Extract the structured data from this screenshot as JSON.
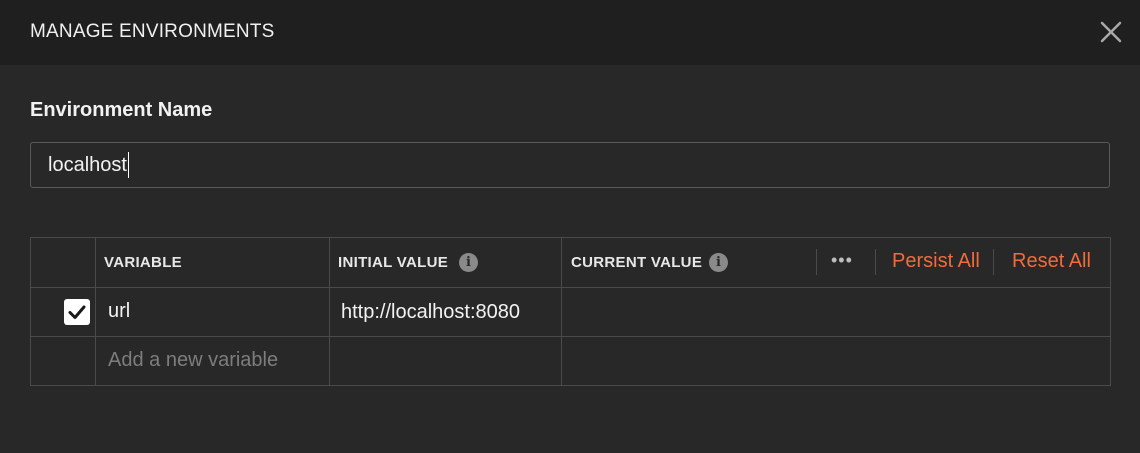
{
  "header": {
    "title": "MANAGE ENVIRONMENTS",
    "close_icon": "close-icon"
  },
  "environment": {
    "name_label": "Environment Name",
    "name_value": "localhost"
  },
  "table": {
    "columns": {
      "variable": "VARIABLE",
      "initial_value": "INITIAL VALUE",
      "current_value": "CURRENT VALUE"
    },
    "info_icon_glyph": "i",
    "more_icon": "more-horizontal-icon",
    "more_glyph": "•••",
    "persist_all": "Persist All",
    "reset_all": "Reset All",
    "rows": [
      {
        "enabled": true,
        "variable": "url",
        "initial_value": "http://localhost:8080",
        "current_value": ""
      }
    ],
    "new_variable_placeholder": "Add a new variable"
  },
  "colors": {
    "accent": "#f26b3a",
    "background": "#282828",
    "header_background": "#1f1f1f",
    "border": "#4a4a4a"
  }
}
